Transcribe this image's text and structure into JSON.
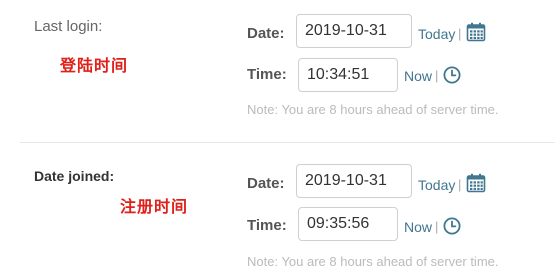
{
  "last_login": {
    "label": "Last login:",
    "annotation": "登陆时间",
    "date_label": "Date:",
    "date_value": "2019-10-31",
    "today_link": "Today",
    "time_label": "Time:",
    "time_value": "10:34:51",
    "now_link": "Now",
    "separator": "|",
    "note": "Note: You are 8 hours ahead of server time."
  },
  "date_joined": {
    "label": "Date joined:",
    "annotation": "注册时间",
    "date_label": "Date:",
    "date_value": "2019-10-31",
    "today_link": "Today",
    "time_label": "Time:",
    "time_value": "09:35:56",
    "now_link": "Now",
    "separator": "|",
    "note": "Note: You are 8 hours ahead of server time."
  },
  "colors": {
    "link": "#417690",
    "annotation": "#e0201b",
    "note": "#bbbbbb"
  },
  "icons": {
    "calendar": "calendar-icon",
    "clock": "clock-icon"
  }
}
